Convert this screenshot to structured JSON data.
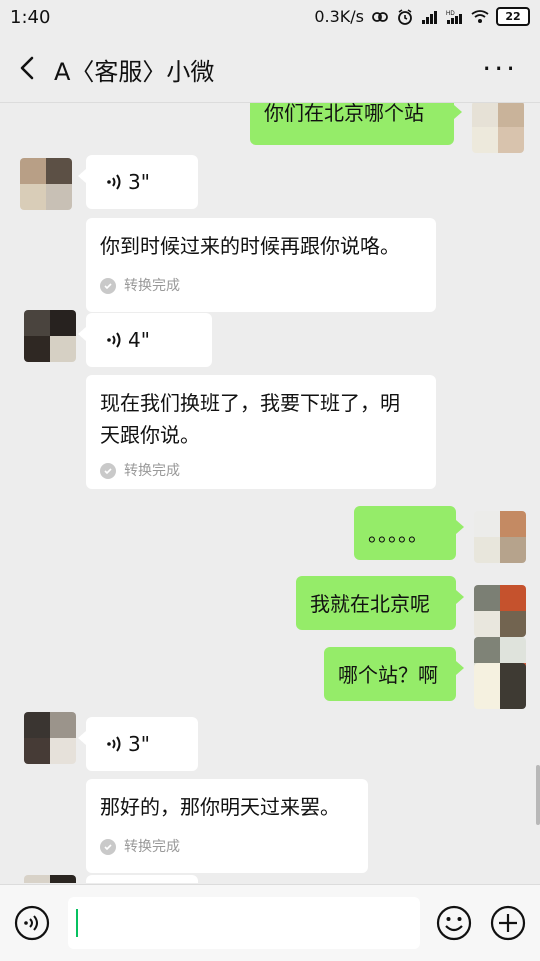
{
  "status_bar": {
    "time": "1:40",
    "network_speed": "0.3K/s",
    "battery_level": "22",
    "icons": [
      "alarm-icon",
      "signal-icon",
      "hd-signal-icon",
      "wifi-icon",
      "battery-icon"
    ]
  },
  "header": {
    "title": "A〈客服〉小微",
    "more_label": "···"
  },
  "messages": {
    "m1": {
      "text": "你们在北京哪个站"
    },
    "m2": {
      "duration": "3\""
    },
    "m3": {
      "text": "你到时候过来的时候再跟你说咯。",
      "status": "转换完成"
    },
    "m4": {
      "duration": "4\""
    },
    "m5": {
      "text_line1": "现在我们换班了，我要下班了，明",
      "text_line2": "天跟你说。",
      "status": "转换完成"
    },
    "m6": {
      "text": "。。。。。"
    },
    "m7": {
      "text": "我就在北京呢"
    },
    "m8": {
      "text": "哪个站？啊"
    },
    "m9": {
      "duration": "3\""
    },
    "m10": {
      "text": "那好的，那你明天过来罢。",
      "status": "转换完成"
    }
  },
  "colors": {
    "background": "#ededed",
    "incoming_bubble": "#ffffff",
    "outgoing_bubble": "#95ec69",
    "accent_cursor": "#07c160"
  },
  "input": {
    "placeholder": ""
  }
}
